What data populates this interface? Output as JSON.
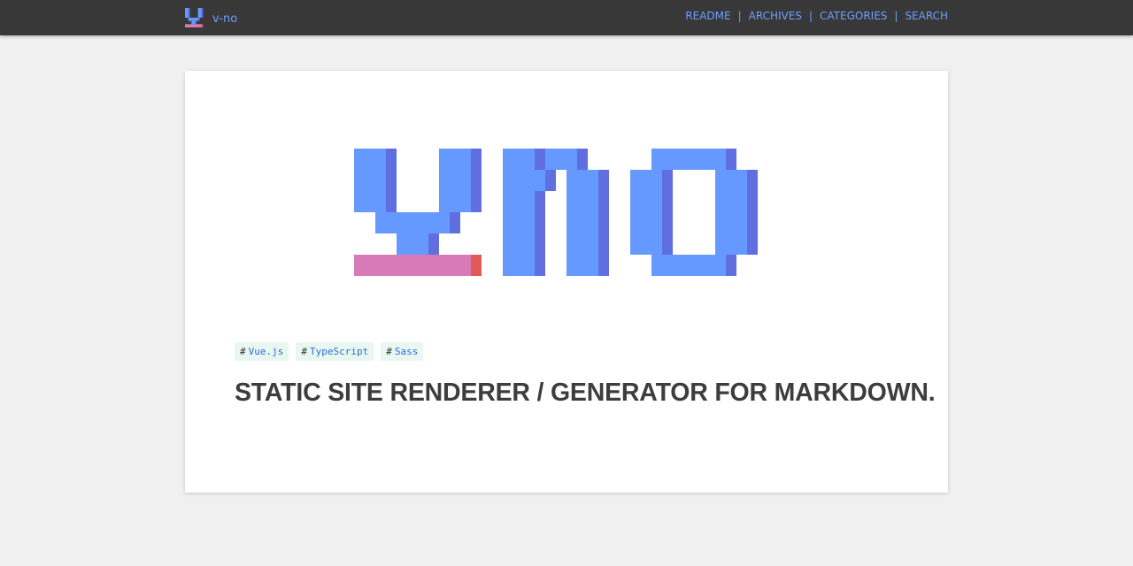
{
  "header": {
    "brand": {
      "name": "v-no",
      "logo_icon": "v-no-logo-icon"
    },
    "nav": {
      "items": [
        {
          "label": "README"
        },
        {
          "label": "ARCHIVES"
        },
        {
          "label": "CATEGORIES"
        },
        {
          "label": "SEARCH"
        }
      ],
      "separator": "|"
    }
  },
  "main": {
    "hero_logo_icon": "v-no-pixel-logo",
    "tags": [
      {
        "hash": "#",
        "label": "Vue.js"
      },
      {
        "hash": "#",
        "label": "TypeScript"
      },
      {
        "hash": "#",
        "label": "Sass"
      }
    ],
    "headline": "STATIC SITE RENDERER / GENERATOR FOR MARKDOWN."
  },
  "colors": {
    "topbar": "#383838",
    "page_background": "#f0f0f0",
    "link": "#6d9eff",
    "logo_blue": "#6699ff",
    "logo_shade": "#5f6fe0",
    "logo_pink": "#d97ab8",
    "logo_red": "#e05a5a",
    "tag_background": "#e9f7f1",
    "tag_text": "#2a6fd6",
    "headline": "#3d3d3d"
  }
}
